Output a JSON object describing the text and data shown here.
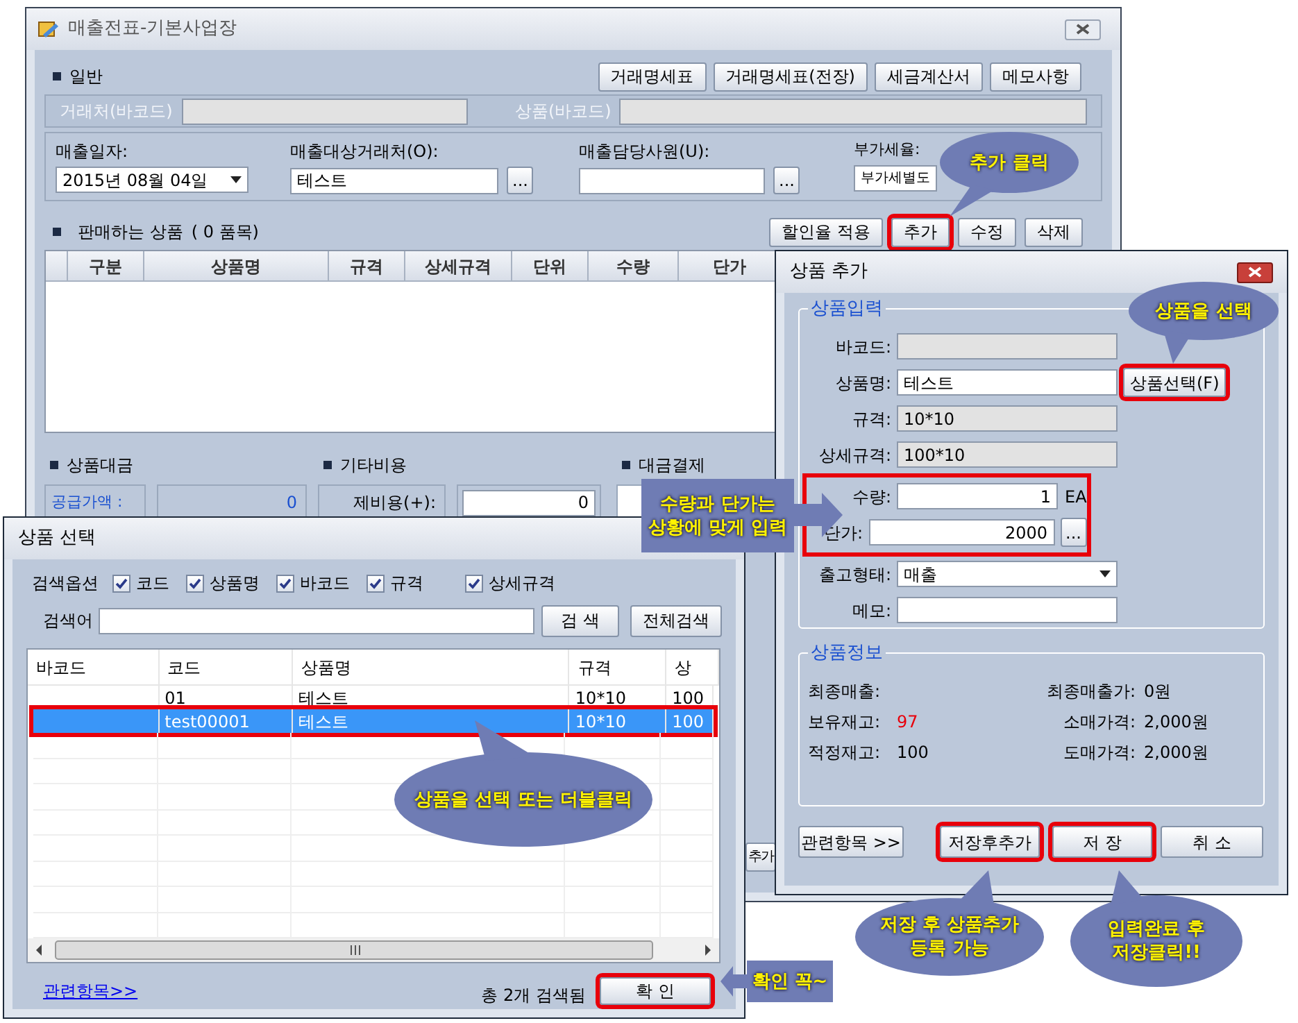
{
  "main_window": {
    "title": "매출전표-기본사업장",
    "general": {
      "heading": "일반",
      "buttons": [
        "거래명세표",
        "거래명세표(전장)",
        "세금계산서",
        "메모사항"
      ]
    },
    "barcode_row": {
      "partner_label": "거래처(바코드)",
      "product_label": "상품(바코드)"
    },
    "fields": [
      {
        "kind": "select",
        "label": "매출일자:",
        "value": "2015년 08월 04일"
      },
      {
        "kind": "lookup",
        "label": "매출대상거래처(O):",
        "value": "테스트",
        "button": "..."
      },
      {
        "kind": "lookup",
        "label": "매출담당사원(U):",
        "button": "..."
      },
      {
        "kind": "text",
        "label": "부가세율:",
        "value": "부가세별도"
      }
    ],
    "products": {
      "heading": "판매하는 상품",
      "count": "( 0 품목)",
      "buttons": [
        {
          "label": "할인율 적용",
          "highlighted": false
        },
        {
          "label": "추가",
          "highlighted": true
        },
        {
          "label": "수정",
          "highlighted": false
        },
        {
          "label": "삭제",
          "highlighted": false
        }
      ],
      "columns": [
        "구분",
        "상품명",
        "규격",
        "상세규격",
        "단위",
        "수량",
        "단가"
      ]
    },
    "summary": [
      {
        "heading": "상품대금",
        "label": "공급가액 :",
        "value": "0"
      },
      {
        "heading": "기타비용",
        "label": "제비용(+):",
        "value": "0"
      },
      {
        "heading": "대금결제"
      }
    ],
    "lower_button": "추가"
  },
  "add_dialog": {
    "title": "상품 추가",
    "input_group": {
      "legend": "상품입력",
      "rows": [
        {
          "kind": "readonly",
          "label": "바코드:"
        },
        {
          "kind": "pick",
          "label": "상품명:",
          "value": "테스트",
          "button": {
            "label": "상품선택(F)",
            "highlighted": true
          }
        },
        {
          "kind": "readonly",
          "label": "규격:",
          "value": "10*10"
        },
        {
          "kind": "readonly",
          "label": "상세규격:",
          "value": "100*10"
        },
        {
          "kind": "unit",
          "label": "수량:",
          "value": "1",
          "unit": "EA"
        },
        {
          "kind": "lookup",
          "label": "단가:",
          "value": "2000",
          "button": "..."
        },
        {
          "kind": "select",
          "label": "출고형태:",
          "value": "매출"
        },
        {
          "kind": "text",
          "label": "메모:"
        }
      ]
    },
    "info_group": {
      "legend": "상품정보",
      "left": [
        {
          "label": "최종매출:"
        },
        {
          "label": "보유재고:",
          "value": "97",
          "alert": true
        },
        {
          "label": "적정재고:",
          "value": "100",
          "alert": false
        }
      ],
      "right": [
        {
          "label": "최종매출가:",
          "value": "0원"
        },
        {
          "label": "소매가격:",
          "value": "2,000원"
        },
        {
          "label": "도매가격:",
          "value": "2,000원"
        }
      ]
    },
    "buttons": [
      {
        "label": "관련항목 >>",
        "highlighted": false
      },
      {
        "label": "저장후추가",
        "highlighted": true
      },
      {
        "label": "저 장",
        "highlighted": true
      },
      {
        "label": "취 소",
        "highlighted": false
      }
    ]
  },
  "select_window": {
    "title": "상품 선택",
    "options_label": "검색옵션",
    "options": [
      {
        "label": "코드",
        "checked": true
      },
      {
        "label": "상품명",
        "checked": true
      },
      {
        "label": "바코드",
        "checked": true
      },
      {
        "label": "규격",
        "checked": true
      },
      {
        "label": "상세규격",
        "checked": true
      }
    ],
    "search_label": "검색어",
    "search_button": "검 색",
    "all_button": "전체검색",
    "columns": [
      "바코드",
      "코드",
      "상품명",
      "규격",
      "상"
    ],
    "rows": [
      {
        "cells": [
          "",
          "01",
          "테스트",
          "10*10",
          "100"
        ],
        "selected": false
      },
      {
        "cells": [
          "",
          "test00001",
          "테스트",
          "10*10",
          "100"
        ],
        "selected": true
      }
    ],
    "related_link": "관련항목>>",
    "result_count": "총 2개 검색됨",
    "ok_button": {
      "label": "확 인",
      "highlighted": true
    }
  },
  "callouts": [
    {
      "kind": "ellipse",
      "lines": [
        "추가 클릭"
      ]
    },
    {
      "kind": "ellipse",
      "lines": [
        "상품을 선택"
      ]
    },
    {
      "kind": "box",
      "lines": [
        "수량과 단가는",
        "상황에 맞게 입력"
      ]
    },
    {
      "kind": "ellipse",
      "lines": [
        "상품을 선택 또는 더블클릭"
      ]
    },
    {
      "kind": "box",
      "lines": [
        "확인 꼭~"
      ]
    },
    {
      "kind": "ellipse",
      "lines": [
        "저장 후 상품추가",
        "등록 가능"
      ]
    },
    {
      "kind": "ellipse",
      "lines": [
        "입력완료 후",
        "저장클릭!!"
      ]
    }
  ]
}
